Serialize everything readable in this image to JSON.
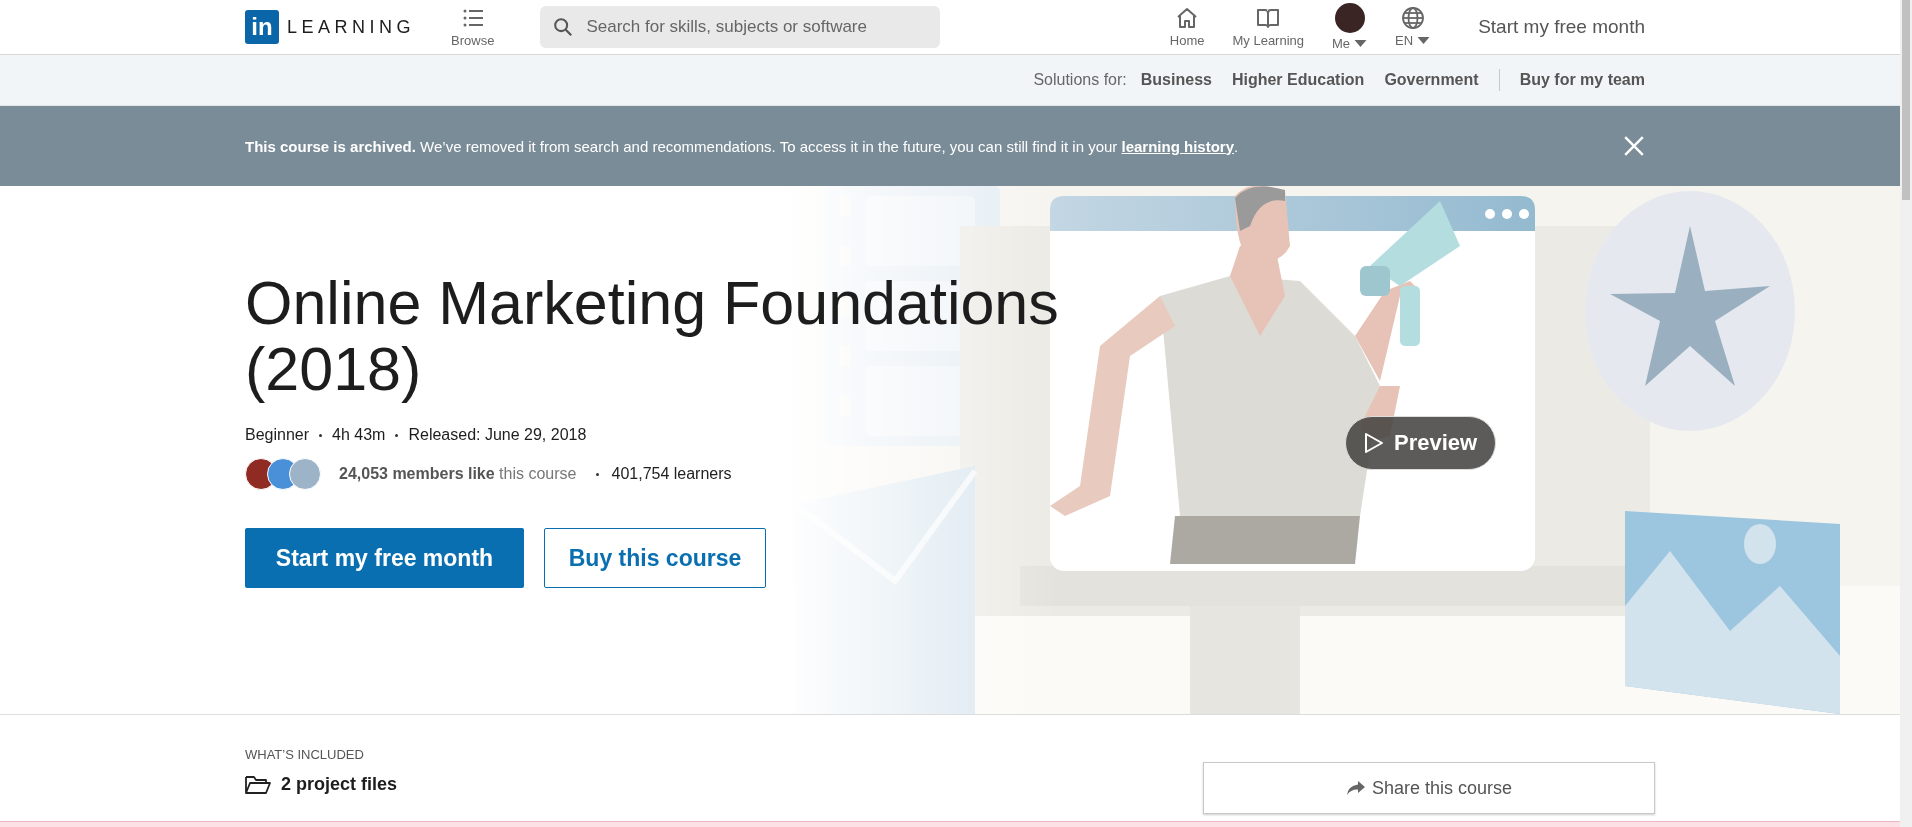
{
  "nav": {
    "logo_mark": "in",
    "logo_text": "LEARNING",
    "browse": "Browse",
    "search": {
      "placeholder": "Search for skills, subjects or software"
    },
    "items": [
      {
        "kind": "home",
        "label": "Home",
        "dropdown": false
      },
      {
        "kind": "book",
        "label": "My Learning",
        "dropdown": false
      },
      {
        "kind": "avatar",
        "label": "Me",
        "dropdown": true
      },
      {
        "kind": "globe",
        "label": "EN",
        "dropdown": true
      }
    ],
    "cta": "Start my free month"
  },
  "subnav": {
    "label": "Solutions for:",
    "links": [
      "Business",
      "Higher Education",
      "Government"
    ],
    "team": "Buy for my team"
  },
  "banner": {
    "text": "**This course is archived.** We’ve removed it from search and recommendations. To access it in the future, you can still find it in your ",
    "link": "learning history",
    "end": "."
  },
  "hero": {
    "title": "Online Marketing Foundations (2018)",
    "meta": [
      "Beginner",
      "4h 43m",
      "Released: June 29, 2018"
    ],
    "likes": "24,053 members like",
    "likes_suffix": "this course",
    "learners": "401,754 learners",
    "primary_button": "Start my free month",
    "secondary_button": "Buy this course",
    "preview": "Preview"
  },
  "included": {
    "heading": "WHAT’S INCLUDED",
    "items": [
      "2 project files"
    ],
    "share": "Share this course"
  }
}
